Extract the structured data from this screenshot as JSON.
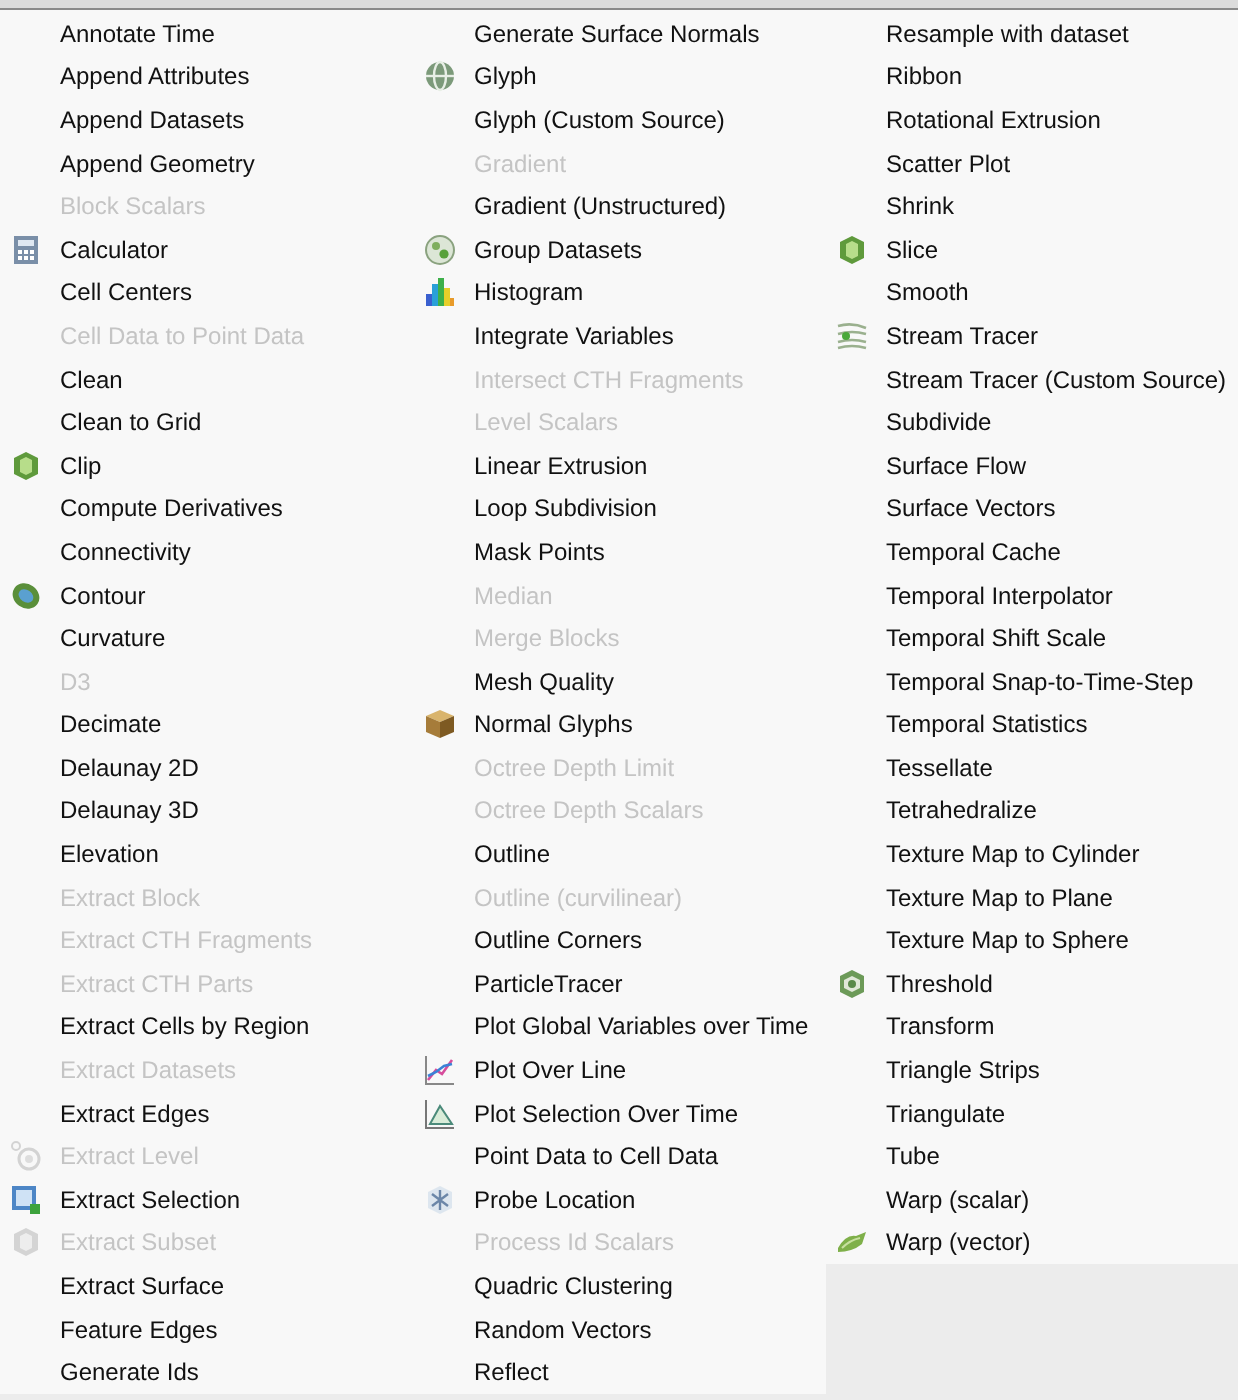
{
  "menu": {
    "columns": [
      {
        "items": [
          {
            "label": "Annotate Time",
            "disabled": false
          },
          {
            "label": "Append Attributes",
            "disabled": false
          },
          {
            "label": "Append Datasets",
            "disabled": false
          },
          {
            "label": "Append Geometry",
            "disabled": false
          },
          {
            "label": "Block Scalars",
            "disabled": true
          },
          {
            "label": "Calculator",
            "disabled": false,
            "kind": "calculator"
          },
          {
            "label": "Cell Centers",
            "disabled": false
          },
          {
            "label": "Cell Data to Point Data",
            "disabled": true
          },
          {
            "label": "Clean",
            "disabled": false
          },
          {
            "label": "Clean to Grid",
            "disabled": false
          },
          {
            "label": "Clip",
            "disabled": false,
            "kind": "cube-green"
          },
          {
            "label": "Compute Derivatives",
            "disabled": false
          },
          {
            "label": "Connectivity",
            "disabled": false
          },
          {
            "label": "Contour",
            "disabled": false,
            "kind": "contour"
          },
          {
            "label": "Curvature",
            "disabled": false
          },
          {
            "label": "D3",
            "disabled": true
          },
          {
            "label": "Decimate",
            "disabled": false
          },
          {
            "label": "Delaunay 2D",
            "disabled": false
          },
          {
            "label": "Delaunay 3D",
            "disabled": false
          },
          {
            "label": "Elevation",
            "disabled": false
          },
          {
            "label": "Extract Block",
            "disabled": true
          },
          {
            "label": "Extract CTH Fragments",
            "disabled": true
          },
          {
            "label": "Extract CTH Parts",
            "disabled": true
          },
          {
            "label": "Extract Cells by Region",
            "disabled": false
          },
          {
            "label": "Extract Datasets",
            "disabled": true
          },
          {
            "label": "Extract Edges",
            "disabled": false
          },
          {
            "label": "Extract Level",
            "disabled": true,
            "kind": "level"
          },
          {
            "label": "Extract Selection",
            "disabled": false,
            "kind": "selection"
          },
          {
            "label": "Extract Subset",
            "disabled": true,
            "kind": "subset"
          },
          {
            "label": "Extract Surface",
            "disabled": false
          },
          {
            "label": "Feature Edges",
            "disabled": false
          },
          {
            "label": "Generate Ids",
            "disabled": false
          }
        ]
      },
      {
        "items": [
          {
            "label": "Generate Surface Normals",
            "disabled": false
          },
          {
            "label": "Glyph",
            "disabled": false,
            "kind": "globe"
          },
          {
            "label": "Glyph (Custom Source)",
            "disabled": false
          },
          {
            "label": "Gradient",
            "disabled": true
          },
          {
            "label": "Gradient (Unstructured)",
            "disabled": false
          },
          {
            "label": "Group Datasets",
            "disabled": false,
            "kind": "group"
          },
          {
            "label": "Histogram",
            "disabled": false,
            "kind": "histogram"
          },
          {
            "label": "Integrate Variables",
            "disabled": false
          },
          {
            "label": "Intersect CTH Fragments",
            "disabled": true
          },
          {
            "label": "Level Scalars",
            "disabled": true
          },
          {
            "label": "Linear Extrusion",
            "disabled": false
          },
          {
            "label": "Loop Subdivision",
            "disabled": false
          },
          {
            "label": "Mask Points",
            "disabled": false
          },
          {
            "label": "Median",
            "disabled": true
          },
          {
            "label": "Merge Blocks",
            "disabled": true
          },
          {
            "label": "Mesh Quality",
            "disabled": false
          },
          {
            "label": "Normal Glyphs",
            "disabled": false,
            "kind": "box"
          },
          {
            "label": "Octree Depth Limit",
            "disabled": true
          },
          {
            "label": "Octree Depth Scalars",
            "disabled": true
          },
          {
            "label": "Outline",
            "disabled": false
          },
          {
            "label": "Outline (curvilinear)",
            "disabled": true
          },
          {
            "label": "Outline Corners",
            "disabled": false
          },
          {
            "label": "ParticleTracer",
            "disabled": false
          },
          {
            "label": "Plot Global Variables over Time",
            "disabled": false
          },
          {
            "label": "Plot Over Line",
            "disabled": false,
            "kind": "line-chart"
          },
          {
            "label": "Plot Selection Over Time",
            "disabled": false,
            "kind": "triangle-chart"
          },
          {
            "label": "Point Data to Cell Data",
            "disabled": false
          },
          {
            "label": "Probe Location",
            "disabled": false,
            "kind": "probe"
          },
          {
            "label": "Process Id Scalars",
            "disabled": true
          },
          {
            "label": "Quadric Clustering",
            "disabled": false
          },
          {
            "label": "Random Vectors",
            "disabled": false
          },
          {
            "label": "Reflect",
            "disabled": false
          }
        ]
      },
      {
        "items": [
          {
            "label": "Resample with dataset",
            "disabled": false
          },
          {
            "label": "Ribbon",
            "disabled": false
          },
          {
            "label": "Rotational Extrusion",
            "disabled": false
          },
          {
            "label": "Scatter Plot",
            "disabled": false
          },
          {
            "label": "Shrink",
            "disabled": false
          },
          {
            "label": "Slice",
            "disabled": false,
            "kind": "cube-green"
          },
          {
            "label": "Smooth",
            "disabled": false
          },
          {
            "label": "Stream Tracer",
            "disabled": false,
            "kind": "stream"
          },
          {
            "label": "Stream Tracer (Custom Source)",
            "disabled": false
          },
          {
            "label": "Subdivide",
            "disabled": false
          },
          {
            "label": "Surface Flow",
            "disabled": false
          },
          {
            "label": "Surface Vectors",
            "disabled": false
          },
          {
            "label": "Temporal Cache",
            "disabled": false
          },
          {
            "label": "Temporal Interpolator",
            "disabled": false
          },
          {
            "label": "Temporal Shift Scale",
            "disabled": false
          },
          {
            "label": "Temporal Snap-to-Time-Step",
            "disabled": false
          },
          {
            "label": "Temporal Statistics",
            "disabled": false
          },
          {
            "label": "Tessellate",
            "disabled": false
          },
          {
            "label": "Tetrahedralize",
            "disabled": false
          },
          {
            "label": "Texture Map to Cylinder",
            "disabled": false
          },
          {
            "label": "Texture Map to Plane",
            "disabled": false
          },
          {
            "label": "Texture Map to Sphere",
            "disabled": false
          },
          {
            "label": "Threshold",
            "disabled": false,
            "kind": "threshold"
          },
          {
            "label": "Transform",
            "disabled": false
          },
          {
            "label": "Triangle Strips",
            "disabled": false
          },
          {
            "label": "Triangulate",
            "disabled": false
          },
          {
            "label": "Tube",
            "disabled": false
          },
          {
            "label": "Warp (scalar)",
            "disabled": false
          },
          {
            "label": "Warp (vector)",
            "disabled": false,
            "kind": "warp"
          }
        ]
      }
    ]
  }
}
